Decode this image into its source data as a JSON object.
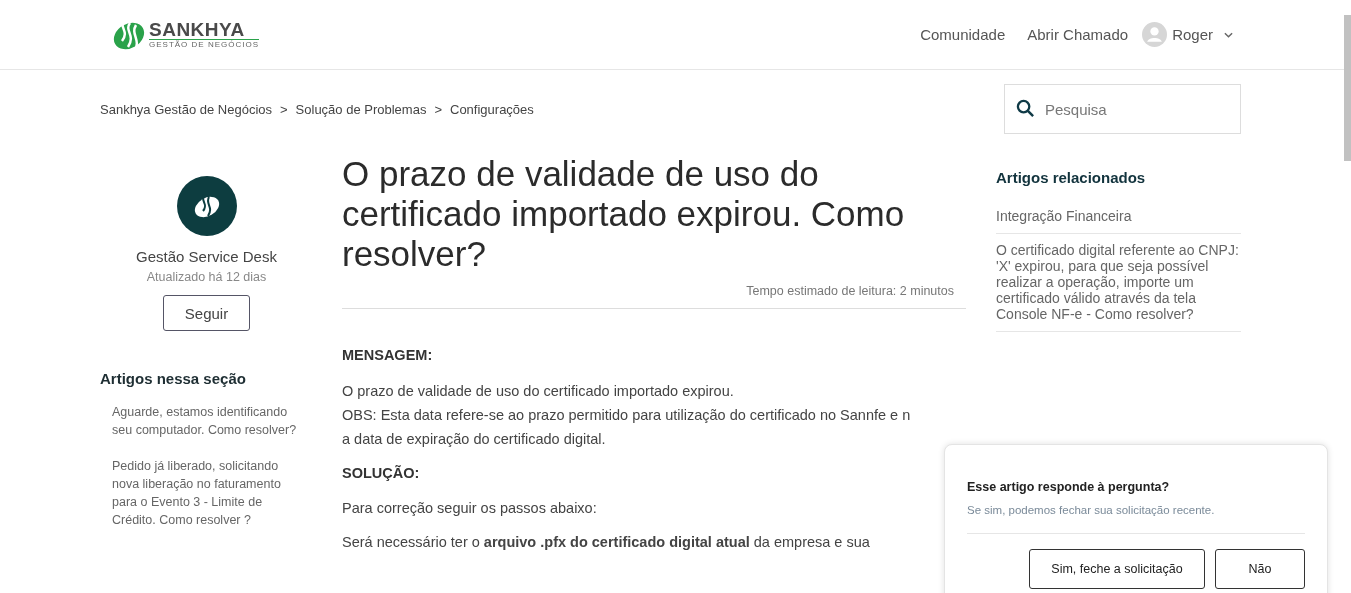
{
  "header": {
    "logo": {
      "name": "SANKHYA",
      "tagline": "GESTÃO DE NEGÓCIOS"
    },
    "nav": [
      "Comunidade",
      "Abrir Chamado"
    ],
    "user": {
      "name": "Roger"
    }
  },
  "breadcrumbs": [
    "Sankhya Gestão de Negócios",
    "Solução de Problemas",
    "Configurações"
  ],
  "breadcrumb_separator": ">",
  "search": {
    "placeholder": "Pesquisa"
  },
  "author": {
    "name": "Gestão Service Desk",
    "updated": "Atualizado há 12 dias",
    "follow_button": "Seguir"
  },
  "section_articles": {
    "title": "Artigos nessa seção",
    "items": [
      "Aguarde, estamos identificando seu computador. Como resolver?",
      "Pedido já liberado, solicitando nova liberação no faturamento para o Evento 3 - Limite de Crédito. Como resolver ?"
    ]
  },
  "article": {
    "title": "O prazo de validade de uso do certificado importado expirou. Como resolver?",
    "reading_time": "Tempo estimado de leitura: 2 minutos",
    "body": [
      {
        "kind": "heading",
        "text": "MENSAGEM:"
      },
      {
        "kind": "lines",
        "lines": [
          "O prazo de validade de uso do certificado importado expirou.",
          "OBS: Esta data refere-se ao prazo permitido para utilização do certificado no Sannfe e n",
          "a data de expiração do certificado digital."
        ]
      },
      {
        "kind": "heading",
        "text": "SOLUÇÃO:"
      },
      {
        "kind": "paragraph",
        "text": "Para correção seguir os passos abaixo:"
      },
      {
        "kind": "paragraph",
        "text": "Será necessário ter o **arquivo .pfx do certificado digital atual** da empresa e sua"
      }
    ]
  },
  "related_articles": {
    "title": "Artigos relacionados",
    "items": [
      "Integração Financeira",
      "O certificado digital referente ao CNPJ: 'X' expirou, para que seja possível realizar a operação, importe um certificado válido através da tela Console NF-e - Como resolver?"
    ]
  },
  "feedback_popup": {
    "question": "Esse artigo responde à pergunta?",
    "hint": "Se sim, podemos fechar sua solicitação recente.",
    "buttons": [
      "Sim, feche a solicitação",
      "Não"
    ]
  }
}
